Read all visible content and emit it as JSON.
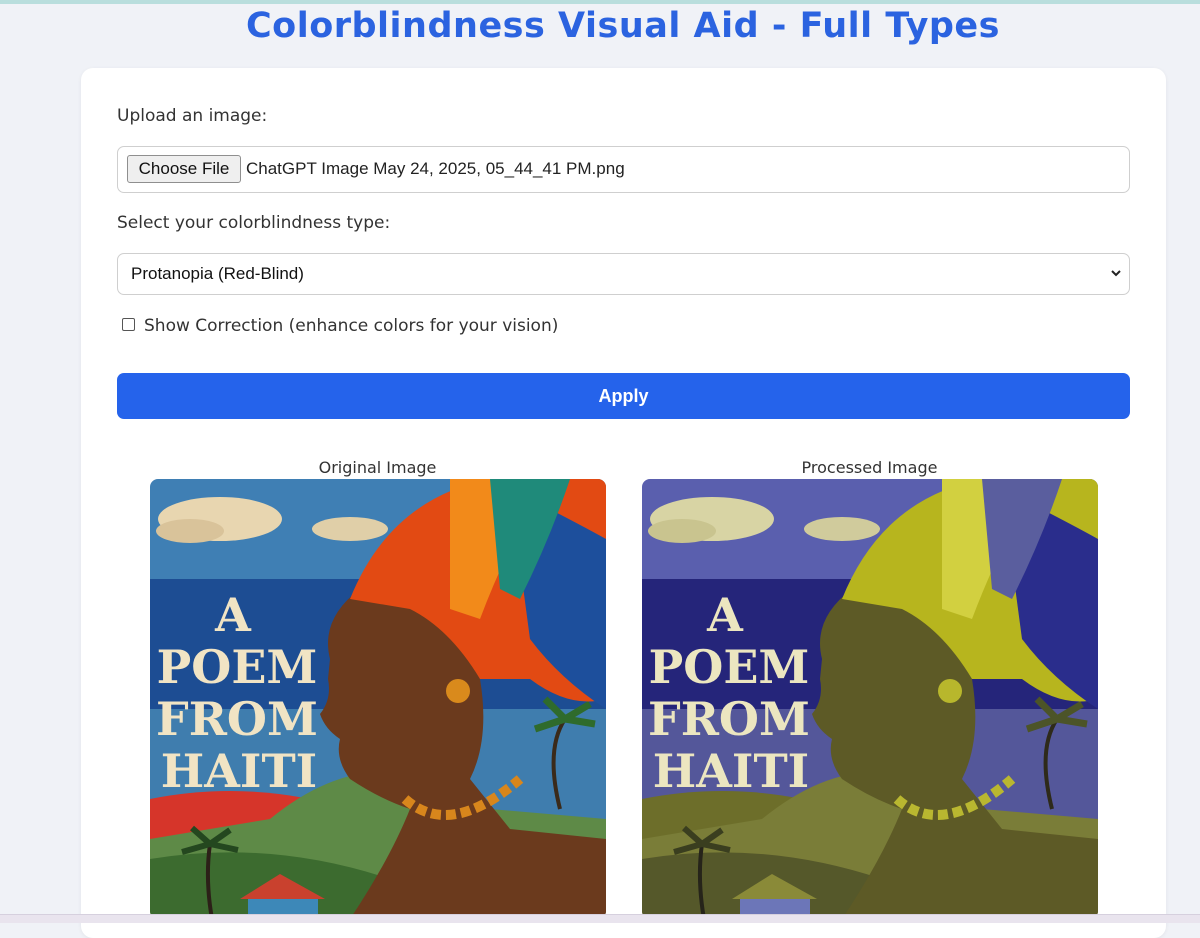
{
  "page": {
    "title": "Colorblindness Visual Aid - Full Types"
  },
  "upload": {
    "label": "Upload an image:",
    "button_label": "Choose File",
    "file_name": "ChatGPT Image May 24, 2025, 05_44_41 PM.png"
  },
  "type_select": {
    "label": "Select your colorblindness type:",
    "selected": "Protanopia (Red-Blind)"
  },
  "correction": {
    "label": "Show Correction (enhance colors for your vision)",
    "checked": false
  },
  "apply_label": "Apply",
  "images": {
    "original_caption": "Original Image",
    "processed_caption": "Processed Image",
    "poster_lines": [
      "A",
      "POEM",
      "FROM",
      "HAITI"
    ]
  },
  "colors": {
    "accent": "#2563eb",
    "title": "#2b63e0"
  },
  "icons": {
    "select_arrow": "chevron-down-icon"
  }
}
